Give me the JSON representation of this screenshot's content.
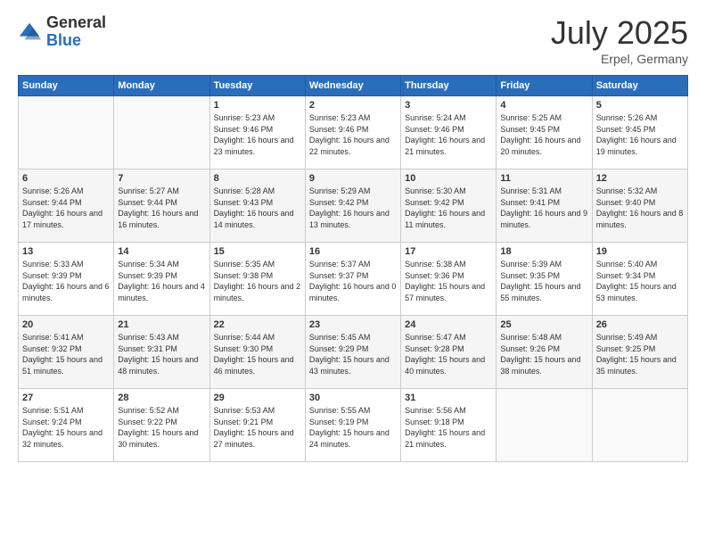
{
  "header": {
    "logo_general": "General",
    "logo_blue": "Blue",
    "month_title": "July 2025",
    "location": "Erpel, Germany"
  },
  "weekdays": [
    "Sunday",
    "Monday",
    "Tuesday",
    "Wednesday",
    "Thursday",
    "Friday",
    "Saturday"
  ],
  "weeks": [
    [
      {
        "day": "",
        "info": ""
      },
      {
        "day": "",
        "info": ""
      },
      {
        "day": "1",
        "info": "Sunrise: 5:23 AM\nSunset: 9:46 PM\nDaylight: 16 hours\nand 23 minutes."
      },
      {
        "day": "2",
        "info": "Sunrise: 5:23 AM\nSunset: 9:46 PM\nDaylight: 16 hours\nand 22 minutes."
      },
      {
        "day": "3",
        "info": "Sunrise: 5:24 AM\nSunset: 9:46 PM\nDaylight: 16 hours\nand 21 minutes."
      },
      {
        "day": "4",
        "info": "Sunrise: 5:25 AM\nSunset: 9:45 PM\nDaylight: 16 hours\nand 20 minutes."
      },
      {
        "day": "5",
        "info": "Sunrise: 5:26 AM\nSunset: 9:45 PM\nDaylight: 16 hours\nand 19 minutes."
      }
    ],
    [
      {
        "day": "6",
        "info": "Sunrise: 5:26 AM\nSunset: 9:44 PM\nDaylight: 16 hours\nand 17 minutes."
      },
      {
        "day": "7",
        "info": "Sunrise: 5:27 AM\nSunset: 9:44 PM\nDaylight: 16 hours\nand 16 minutes."
      },
      {
        "day": "8",
        "info": "Sunrise: 5:28 AM\nSunset: 9:43 PM\nDaylight: 16 hours\nand 14 minutes."
      },
      {
        "day": "9",
        "info": "Sunrise: 5:29 AM\nSunset: 9:42 PM\nDaylight: 16 hours\nand 13 minutes."
      },
      {
        "day": "10",
        "info": "Sunrise: 5:30 AM\nSunset: 9:42 PM\nDaylight: 16 hours\nand 11 minutes."
      },
      {
        "day": "11",
        "info": "Sunrise: 5:31 AM\nSunset: 9:41 PM\nDaylight: 16 hours\nand 9 minutes."
      },
      {
        "day": "12",
        "info": "Sunrise: 5:32 AM\nSunset: 9:40 PM\nDaylight: 16 hours\nand 8 minutes."
      }
    ],
    [
      {
        "day": "13",
        "info": "Sunrise: 5:33 AM\nSunset: 9:39 PM\nDaylight: 16 hours\nand 6 minutes."
      },
      {
        "day": "14",
        "info": "Sunrise: 5:34 AM\nSunset: 9:39 PM\nDaylight: 16 hours\nand 4 minutes."
      },
      {
        "day": "15",
        "info": "Sunrise: 5:35 AM\nSunset: 9:38 PM\nDaylight: 16 hours\nand 2 minutes."
      },
      {
        "day": "16",
        "info": "Sunrise: 5:37 AM\nSunset: 9:37 PM\nDaylight: 16 hours\nand 0 minutes."
      },
      {
        "day": "17",
        "info": "Sunrise: 5:38 AM\nSunset: 9:36 PM\nDaylight: 15 hours\nand 57 minutes."
      },
      {
        "day": "18",
        "info": "Sunrise: 5:39 AM\nSunset: 9:35 PM\nDaylight: 15 hours\nand 55 minutes."
      },
      {
        "day": "19",
        "info": "Sunrise: 5:40 AM\nSunset: 9:34 PM\nDaylight: 15 hours\nand 53 minutes."
      }
    ],
    [
      {
        "day": "20",
        "info": "Sunrise: 5:41 AM\nSunset: 9:32 PM\nDaylight: 15 hours\nand 51 minutes."
      },
      {
        "day": "21",
        "info": "Sunrise: 5:43 AM\nSunset: 9:31 PM\nDaylight: 15 hours\nand 48 minutes."
      },
      {
        "day": "22",
        "info": "Sunrise: 5:44 AM\nSunset: 9:30 PM\nDaylight: 15 hours\nand 46 minutes."
      },
      {
        "day": "23",
        "info": "Sunrise: 5:45 AM\nSunset: 9:29 PM\nDaylight: 15 hours\nand 43 minutes."
      },
      {
        "day": "24",
        "info": "Sunrise: 5:47 AM\nSunset: 9:28 PM\nDaylight: 15 hours\nand 40 minutes."
      },
      {
        "day": "25",
        "info": "Sunrise: 5:48 AM\nSunset: 9:26 PM\nDaylight: 15 hours\nand 38 minutes."
      },
      {
        "day": "26",
        "info": "Sunrise: 5:49 AM\nSunset: 9:25 PM\nDaylight: 15 hours\nand 35 minutes."
      }
    ],
    [
      {
        "day": "27",
        "info": "Sunrise: 5:51 AM\nSunset: 9:24 PM\nDaylight: 15 hours\nand 32 minutes."
      },
      {
        "day": "28",
        "info": "Sunrise: 5:52 AM\nSunset: 9:22 PM\nDaylight: 15 hours\nand 30 minutes."
      },
      {
        "day": "29",
        "info": "Sunrise: 5:53 AM\nSunset: 9:21 PM\nDaylight: 15 hours\nand 27 minutes."
      },
      {
        "day": "30",
        "info": "Sunrise: 5:55 AM\nSunset: 9:19 PM\nDaylight: 15 hours\nand 24 minutes."
      },
      {
        "day": "31",
        "info": "Sunrise: 5:56 AM\nSunset: 9:18 PM\nDaylight: 15 hours\nand 21 minutes."
      },
      {
        "day": "",
        "info": ""
      },
      {
        "day": "",
        "info": ""
      }
    ]
  ]
}
